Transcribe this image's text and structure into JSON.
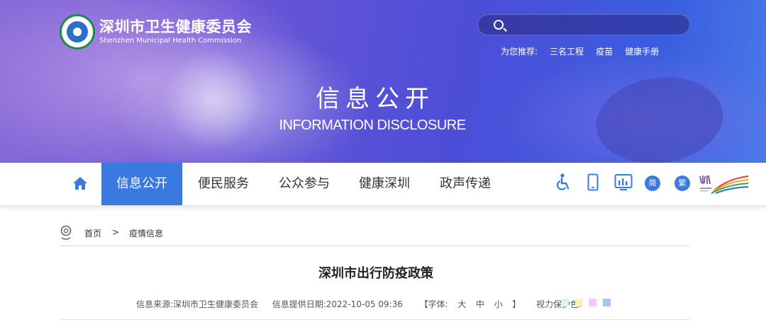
{
  "header": {
    "org_name_cn": "深圳市卫生健康委员会",
    "org_name_en": "Shenzhen Municipal Health Commission",
    "search_placeholder": "",
    "recommend_label": "为您推荐:",
    "recommend_links": [
      "三名工程",
      "疫苗",
      "健康手册"
    ],
    "hero_title_cn": "信息公开",
    "hero_title_en": "INFORMATION DISCLOSURE"
  },
  "nav": {
    "items": [
      "信息公开",
      "便民服务",
      "公众参与",
      "健康深圳",
      "政声传递"
    ],
    "active_index": 0,
    "simplified_label": "简",
    "traditional_label": "繁",
    "accent_color": "#3a7ae0"
  },
  "breadcrumb": {
    "home": "首页",
    "separator": ">",
    "current": "疫情信息"
  },
  "article": {
    "title": "深圳市出行防疫政策",
    "source": "信息来源:深圳市卫生健康委员会",
    "date": "信息提供日期:2022-10-05 09:36",
    "font_size_label": "【字体:",
    "font_large": "大",
    "font_medium": "中",
    "font_small": "小",
    "font_close": "】",
    "eye_protect_label": "视力保护色:",
    "eye_colors": [
      "#d9f4f5",
      "#f6f3b9",
      "#f7c9f0",
      "#a9c4f0"
    ]
  }
}
